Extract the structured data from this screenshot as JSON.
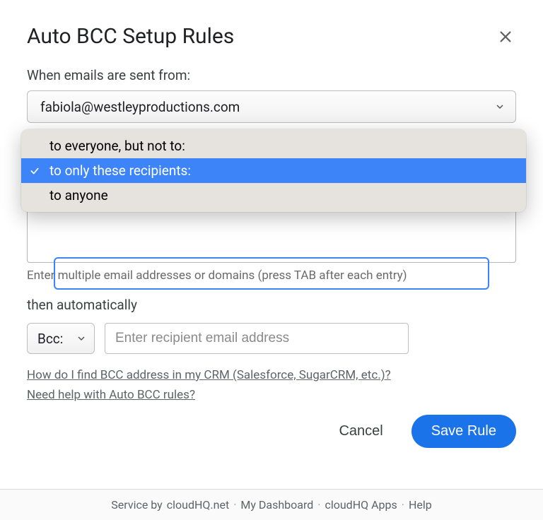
{
  "title": "Auto BCC Setup Rules",
  "labels": {
    "from": "When emails are sent from:",
    "then": "then automatically"
  },
  "from_select": {
    "value": "fabiola@westleyproductions.com"
  },
  "recipient_mode": {
    "options": [
      {
        "label": "to everyone, but not to:",
        "selected": false
      },
      {
        "label": "to only these recipients:",
        "selected": true
      },
      {
        "label": "to anyone",
        "selected": false
      }
    ]
  },
  "recipients_hint": "Enter multiple email addresses or domains (press TAB after each entry)",
  "bcc_select": {
    "value": "Bcc:"
  },
  "recipient_input": {
    "placeholder": "Enter recipient email address",
    "value": ""
  },
  "help_links": {
    "crm": "How do I find BCC address in my CRM (Salesforce, SugarCRM, etc.)?",
    "rules": "Need help with Auto BCC rules?"
  },
  "buttons": {
    "cancel": "Cancel",
    "save": "Save Rule"
  },
  "footer": {
    "service_prefix": "Service by ",
    "service_host": "cloudHQ.net",
    "dashboard": "My Dashboard",
    "apps": "cloudHQ Apps",
    "help": "Help"
  }
}
